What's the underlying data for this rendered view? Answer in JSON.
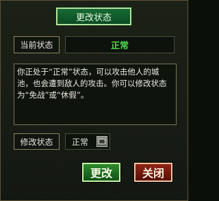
{
  "dialog": {
    "title": "更改状态",
    "current_status_label": "当前状态",
    "current_status_value": "正常",
    "description": "你正处于“正常”状态，可以攻击他人的城池，也会遭到敌人的攻击。你可以修改状态为“免战”或“休假”。",
    "change_status_label": "修改状态",
    "status_select": {
      "selected": "正常",
      "icon": "dropdown-arrow-icon"
    },
    "confirm_button": "更改",
    "close_button": "关闭"
  },
  "colors": {
    "status_text": "#4cd84c",
    "confirm_button_bg": "#2d8b2b",
    "close_button_bg": "#8e2515",
    "title_bg": "#176a35"
  }
}
